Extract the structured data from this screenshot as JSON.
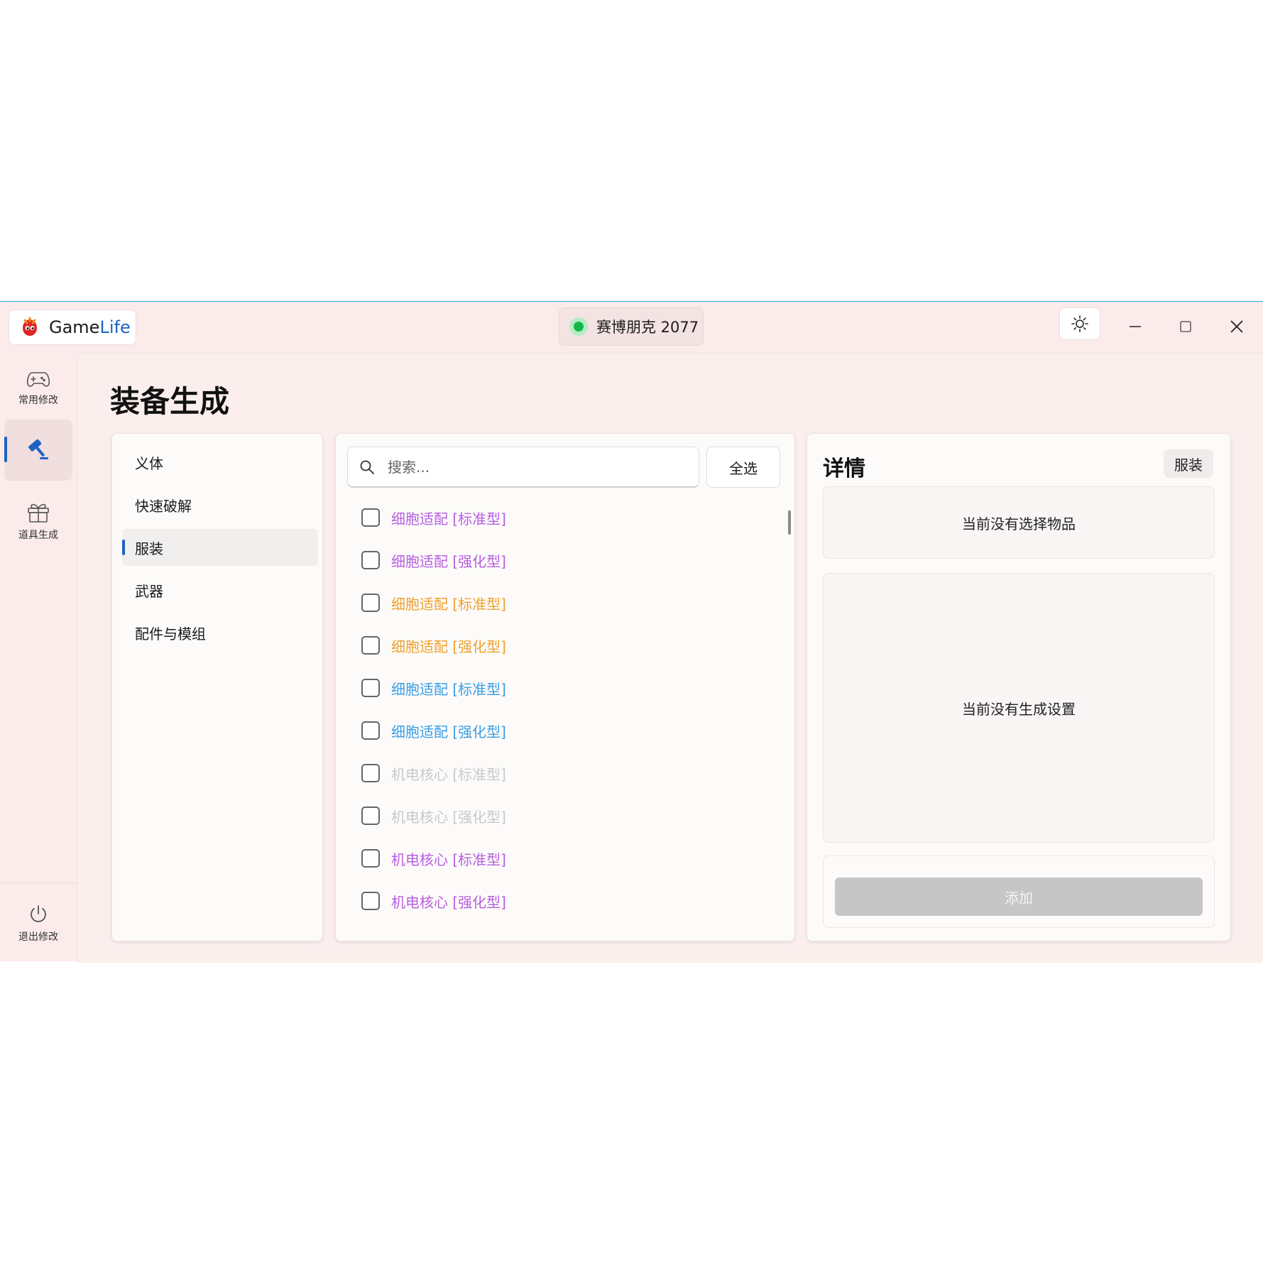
{
  "titlebar": {
    "brand_game": "Game",
    "brand_life": "Life",
    "current_game": "赛博朋克 2077"
  },
  "rail": {
    "items": [
      {
        "label": "常用修改",
        "icon": "gamepad-icon"
      },
      {
        "label": "",
        "icon": "gavel-icon"
      },
      {
        "label": "道具生成",
        "icon": "gift-icon"
      }
    ],
    "exit_label": "退出修改"
  },
  "page": {
    "title": "装备生成"
  },
  "categories": [
    "义体",
    "快速破解",
    "服装",
    "武器",
    "配件与模组"
  ],
  "active_category": "服装",
  "search": {
    "placeholder": "搜索..."
  },
  "select_all_label": "全选",
  "items": [
    {
      "label": "细胞适配 [标准型]",
      "color": "#b65fe0"
    },
    {
      "label": "细胞适配 [强化型]",
      "color": "#b65fe0"
    },
    {
      "label": "细胞适配 [标准型]",
      "color": "#f0a02c"
    },
    {
      "label": "细胞适配 [强化型]",
      "color": "#f0a02c"
    },
    {
      "label": "细胞适配 [标准型]",
      "color": "#3a9ee4"
    },
    {
      "label": "细胞适配 [强化型]",
      "color": "#3a9ee4"
    },
    {
      "label": "机电核心 [标准型]",
      "color": "#c9c9c9"
    },
    {
      "label": "机电核心 [强化型]",
      "color": "#c9c9c9"
    },
    {
      "label": "机电核心 [标准型]",
      "color": "#b65fe0"
    },
    {
      "label": "机电核心 [强化型]",
      "color": "#b65fe0"
    }
  ],
  "detail": {
    "title": "详情",
    "tag": "服装",
    "no_item": "当前没有选择物品",
    "no_settings": "当前没有生成设置",
    "add_label": "添加"
  },
  "colors": {
    "accent": "#1c63c4",
    "status_online": "#13b84a",
    "window_bg": "#fbeceb"
  }
}
